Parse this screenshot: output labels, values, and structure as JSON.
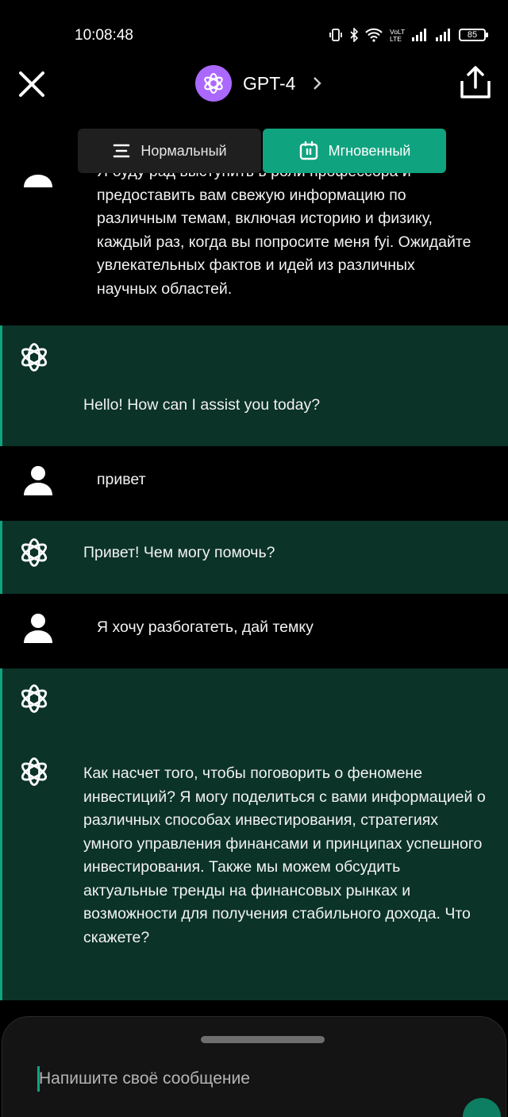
{
  "status_bar": {
    "time": "10:08:48",
    "icons": [
      "vibrate-icon",
      "bluetooth-icon",
      "wifi-icon",
      "volte-icon",
      "signal-icon",
      "signal-icon",
      "battery-icon"
    ],
    "network_label": "VoLTE",
    "battery_level": "85"
  },
  "header": {
    "model_name": "GPT-4",
    "logo_color": "#ab68ff",
    "icons": {
      "close": "close-icon",
      "chevron": "chevron-right-icon",
      "share": "share-icon"
    }
  },
  "mode_switch": {
    "normal_label": "Нормальный",
    "instant_label": "Мгновенный",
    "selected": "instant",
    "accent_color": "#10a37f"
  },
  "messages": [
    {
      "role": "user",
      "text": "Я буду рад выступить в роли профессора и предоставить вам свежую информацию по различным темам, включая историю и физику, каждый раз, когда вы попросите меня fyi. Ожидайте увлекательных фактов и идей из различных научных областей."
    },
    {
      "role": "assistant",
      "text": "Hello! How can I assist you today?"
    },
    {
      "role": "user",
      "text": "привет"
    },
    {
      "role": "assistant",
      "text": "Привет! Чем могу помочь?"
    },
    {
      "role": "user",
      "text": "Я хочу разбогатеть, дай темку"
    },
    {
      "role": "assistant",
      "text": "Как насчет того, чтобы поговорить о феномене инвестиций? Я могу поделиться с вами информацией о различных способах инвестирования, стратегиях умного управления финансами и принципах успешного инвестирования. Также мы можем обсудить актуальные тренды на финансовых рынках и возможности для получения стабильного дохода. Что скажете?"
    }
  ],
  "composer": {
    "placeholder": "Напишите своё сообщение"
  }
}
